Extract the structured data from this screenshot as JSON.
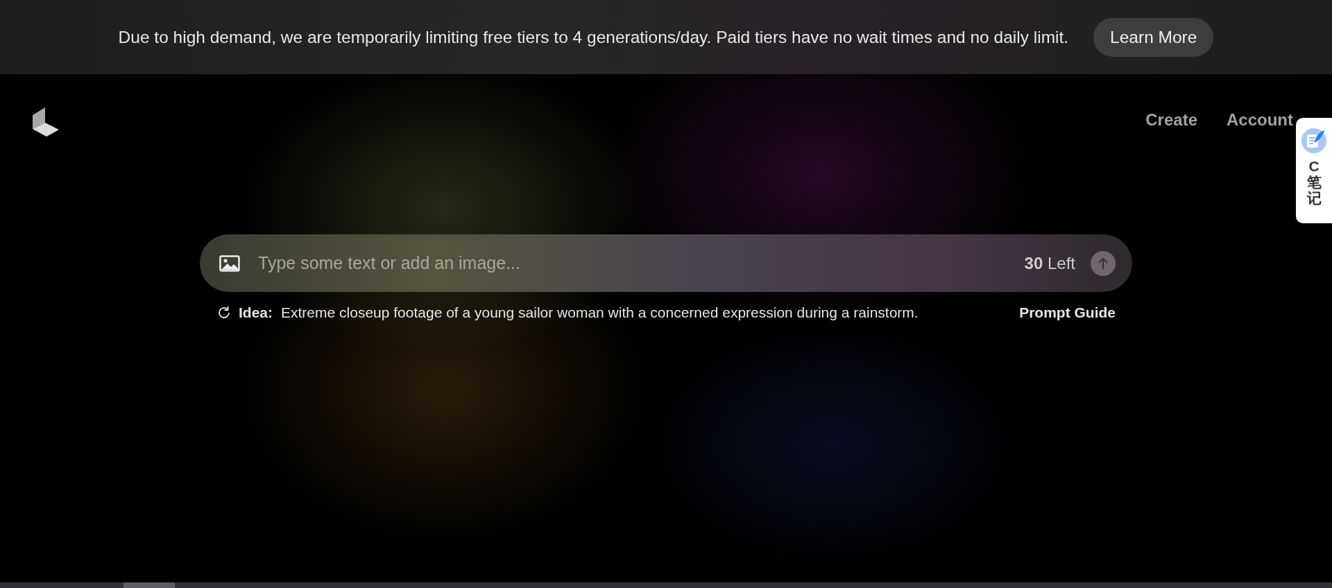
{
  "banner": {
    "message": "Due to high demand, we are temporarily limiting free tiers to 4 generations/day. Paid tiers have no wait times and no daily limit.",
    "button": "Learn More"
  },
  "nav": {
    "links": [
      {
        "label": "Create"
      },
      {
        "label": "Account"
      }
    ]
  },
  "prompt": {
    "placeholder": "Type some text or add an image...",
    "remaining": "**30** Left"
  },
  "idea": {
    "label": "Idea:",
    "text": "Extreme closeup footage of a young sailor woman with a concerned expression during a rainstorm.",
    "guide": "Prompt Guide"
  },
  "side_widget": {
    "label": "C笔记"
  }
}
